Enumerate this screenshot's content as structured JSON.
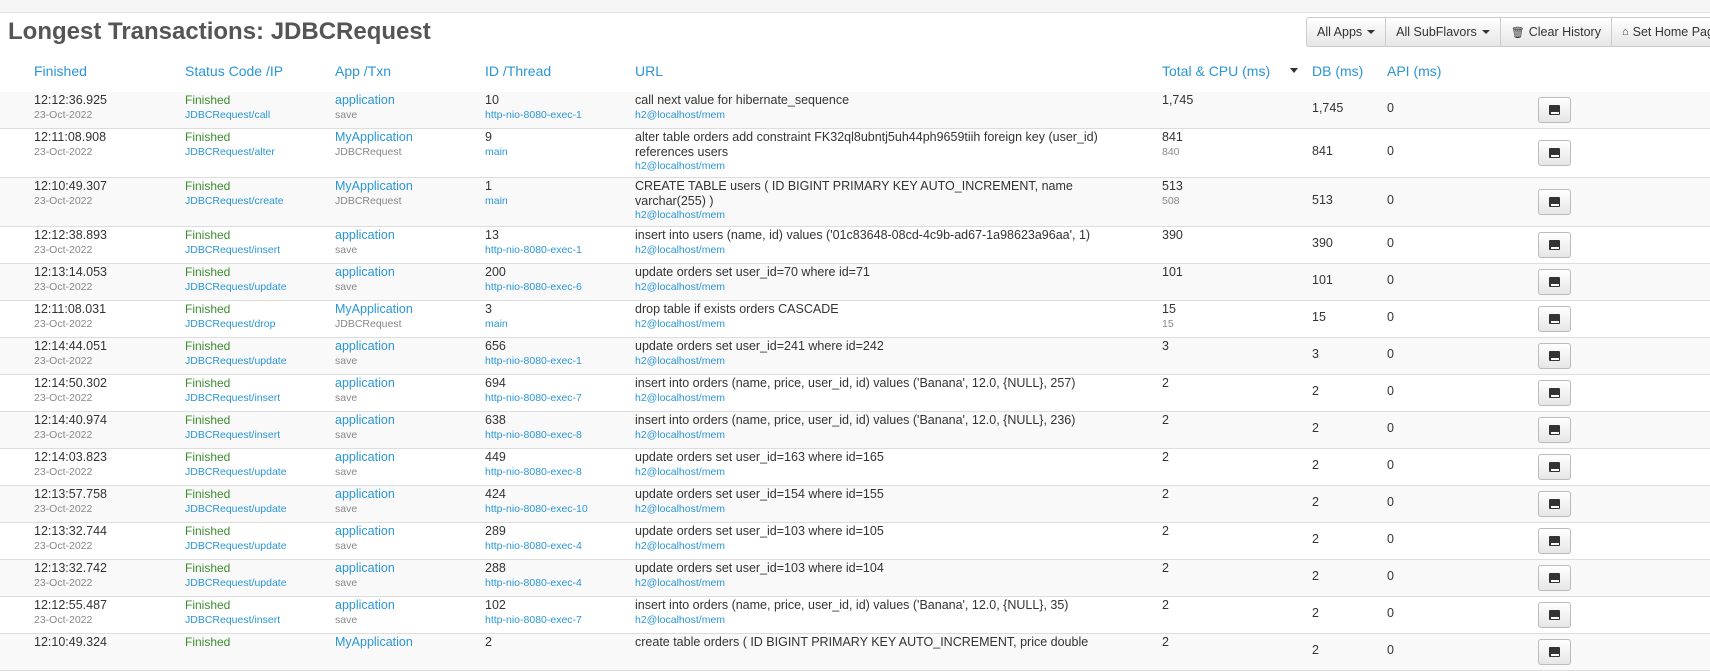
{
  "page": {
    "title": "Longest Transactions: JDBCRequest"
  },
  "toolbar": {
    "all_apps": "All Apps",
    "all_subflavors": "All SubFlavors",
    "clear_history": "Clear History",
    "set_home_page": "Set Home Page"
  },
  "columns": {
    "finished": "Finished",
    "status": "Status Code /IP",
    "app": "App /Txn",
    "id": "ID /Thread",
    "url": "URL",
    "total": "Total & CPU (ms)",
    "db": "DB (ms)",
    "api": "API (ms)"
  },
  "rows": [
    {
      "time": "12:12:36.925",
      "date": "23-Oct-2022",
      "status": "Finished",
      "request": "JDBCRequest/call",
      "app": "application",
      "txn": "save",
      "id": "10",
      "thread": "http-nio-8080-exec-1",
      "url": "call next value for hibernate_sequence",
      "url_sub": "h2@localhost/mem",
      "total": "1,745",
      "cpu": "",
      "db": "1,745",
      "api": "0"
    },
    {
      "time": "12:11:08.908",
      "date": "23-Oct-2022",
      "status": "Finished",
      "request": "JDBCRequest/alter",
      "app": "MyApplication",
      "txn": "JDBCRequest",
      "id": "9",
      "thread": "main",
      "url": "alter table orders add constraint FK32ql8ubntj5uh44ph9659tiih foreign key (user_id) references users",
      "url_sub": "h2@localhost/mem",
      "total": "841",
      "cpu": "840",
      "db": "841",
      "api": "0"
    },
    {
      "time": "12:10:49.307",
      "date": "23-Oct-2022",
      "status": "Finished",
      "request": "JDBCRequest/create",
      "app": "MyApplication",
      "txn": "JDBCRequest",
      "id": "1",
      "thread": "main",
      "url": "CREATE TABLE users ( ID BIGINT PRIMARY KEY AUTO_INCREMENT, name varchar(255) )",
      "url_sub": "h2@localhost/mem",
      "total": "513",
      "cpu": "508",
      "db": "513",
      "api": "0"
    },
    {
      "time": "12:12:38.893",
      "date": "23-Oct-2022",
      "status": "Finished",
      "request": "JDBCRequest/insert",
      "app": "application",
      "txn": "save",
      "id": "13",
      "thread": "http-nio-8080-exec-1",
      "url": "insert into users (name, id) values ('01c83648-08cd-4c9b-ad67-1a98623a96aa', 1)",
      "url_sub": "h2@localhost/mem",
      "total": "390",
      "cpu": "",
      "db": "390",
      "api": "0"
    },
    {
      "time": "12:13:14.053",
      "date": "23-Oct-2022",
      "status": "Finished",
      "request": "JDBCRequest/update",
      "app": "application",
      "txn": "save",
      "id": "200",
      "thread": "http-nio-8080-exec-6",
      "url": "update orders set user_id=70 where id=71",
      "url_sub": "h2@localhost/mem",
      "total": "101",
      "cpu": "",
      "db": "101",
      "api": "0"
    },
    {
      "time": "12:11:08.031",
      "date": "23-Oct-2022",
      "status": "Finished",
      "request": "JDBCRequest/drop",
      "app": "MyApplication",
      "txn": "JDBCRequest",
      "id": "3",
      "thread": "main",
      "url": "drop table if exists orders CASCADE",
      "url_sub": "h2@localhost/mem",
      "total": "15",
      "cpu": "15",
      "db": "15",
      "api": "0"
    },
    {
      "time": "12:14:44.051",
      "date": "23-Oct-2022",
      "status": "Finished",
      "request": "JDBCRequest/update",
      "app": "application",
      "txn": "save",
      "id": "656",
      "thread": "http-nio-8080-exec-1",
      "url": "update orders set user_id=241 where id=242",
      "url_sub": "h2@localhost/mem",
      "total": "3",
      "cpu": "",
      "db": "3",
      "api": "0"
    },
    {
      "time": "12:14:50.302",
      "date": "23-Oct-2022",
      "status": "Finished",
      "request": "JDBCRequest/insert",
      "app": "application",
      "txn": "save",
      "id": "694",
      "thread": "http-nio-8080-exec-7",
      "url": "insert into orders (name, price, user_id, id) values ('Banana', 12.0, {NULL}, 257)",
      "url_sub": "h2@localhost/mem",
      "total": "2",
      "cpu": "",
      "db": "2",
      "api": "0"
    },
    {
      "time": "12:14:40.974",
      "date": "23-Oct-2022",
      "status": "Finished",
      "request": "JDBCRequest/insert",
      "app": "application",
      "txn": "save",
      "id": "638",
      "thread": "http-nio-8080-exec-8",
      "url": "insert into orders (name, price, user_id, id) values ('Banana', 12.0, {NULL}, 236)",
      "url_sub": "h2@localhost/mem",
      "total": "2",
      "cpu": "",
      "db": "2",
      "api": "0"
    },
    {
      "time": "12:14:03.823",
      "date": "23-Oct-2022",
      "status": "Finished",
      "request": "JDBCRequest/update",
      "app": "application",
      "txn": "save",
      "id": "449",
      "thread": "http-nio-8080-exec-8",
      "url": "update orders set user_id=163 where id=165",
      "url_sub": "h2@localhost/mem",
      "total": "2",
      "cpu": "",
      "db": "2",
      "api": "0"
    },
    {
      "time": "12:13:57.758",
      "date": "23-Oct-2022",
      "status": "Finished",
      "request": "JDBCRequest/update",
      "app": "application",
      "txn": "save",
      "id": "424",
      "thread": "http-nio-8080-exec-10",
      "url": "update orders set user_id=154 where id=155",
      "url_sub": "h2@localhost/mem",
      "total": "2",
      "cpu": "",
      "db": "2",
      "api": "0"
    },
    {
      "time": "12:13:32.744",
      "date": "23-Oct-2022",
      "status": "Finished",
      "request": "JDBCRequest/update",
      "app": "application",
      "txn": "save",
      "id": "289",
      "thread": "http-nio-8080-exec-4",
      "url": "update orders set user_id=103 where id=105",
      "url_sub": "h2@localhost/mem",
      "total": "2",
      "cpu": "",
      "db": "2",
      "api": "0"
    },
    {
      "time": "12:13:32.742",
      "date": "23-Oct-2022",
      "status": "Finished",
      "request": "JDBCRequest/update",
      "app": "application",
      "txn": "save",
      "id": "288",
      "thread": "http-nio-8080-exec-4",
      "url": "update orders set user_id=103 where id=104",
      "url_sub": "h2@localhost/mem",
      "total": "2",
      "cpu": "",
      "db": "2",
      "api": "0"
    },
    {
      "time": "12:12:55.487",
      "date": "23-Oct-2022",
      "status": "Finished",
      "request": "JDBCRequest/insert",
      "app": "application",
      "txn": "save",
      "id": "102",
      "thread": "http-nio-8080-exec-7",
      "url": "insert into orders (name, price, user_id, id) values ('Banana', 12.0, {NULL}, 35)",
      "url_sub": "h2@localhost/mem",
      "total": "2",
      "cpu": "",
      "db": "2",
      "api": "0"
    },
    {
      "time": "12:10:49.324",
      "date": "",
      "status": "Finished",
      "request": "",
      "app": "MyApplication",
      "txn": "",
      "id": "2",
      "thread": "",
      "url": "create table orders ( ID BIGINT PRIMARY KEY AUTO_INCREMENT, price double",
      "url_sub": "",
      "total": "2",
      "cpu": "",
      "db": "2",
      "api": "0"
    }
  ]
}
